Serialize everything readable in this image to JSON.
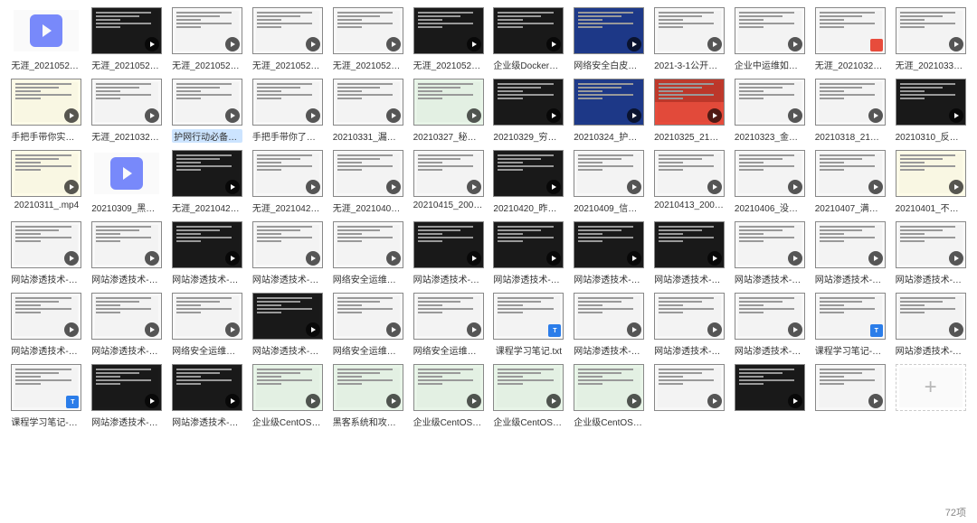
{
  "footer": "72项",
  "items": [
    {
      "label": "无涯_20210520_...",
      "type": "video-icon",
      "thumb": "vicon"
    },
    {
      "label": "无涯_20210521_...",
      "type": "video",
      "thumb": "dark"
    },
    {
      "label": "无涯_20210522_...",
      "type": "video",
      "thumb": "light"
    },
    {
      "label": "无涯_20210527_...",
      "type": "video",
      "thumb": "light"
    },
    {
      "label": "无涯_20210528_...",
      "type": "video",
      "thumb": "light"
    },
    {
      "label": "无涯_20210529_...",
      "type": "video",
      "thumb": "dark"
    },
    {
      "label": "企业级Docker容...",
      "type": "video",
      "thumb": "dark"
    },
    {
      "label": "网络安全白皮书V...",
      "type": "video",
      "thumb": "blue"
    },
    {
      "label": "2021-3-1公开课...",
      "type": "video",
      "thumb": "light"
    },
    {
      "label": "企业中运维如对...",
      "type": "video",
      "thumb": "light"
    },
    {
      "label": "无涯_20210328_...",
      "type": "pdf",
      "thumb": "light"
    },
    {
      "label": "无涯_20210330_...",
      "type": "video",
      "thumb": "light"
    },
    {
      "label": "手把手带你实现...",
      "type": "video",
      "thumb": "yellow"
    },
    {
      "label": "无涯_20210326_...",
      "type": "video",
      "thumb": "light"
    },
    {
      "label": "护网行动必备技...",
      "type": "video",
      "thumb": "light",
      "highlight": true
    },
    {
      "label": "手把手带你了解...",
      "type": "video",
      "thumb": "light"
    },
    {
      "label": "20210331_漏洞...",
      "type": "video",
      "thumb": "light"
    },
    {
      "label": "20210327_秘钥...",
      "type": "video",
      "thumb": "green"
    },
    {
      "label": "20210329_穷追...",
      "type": "video",
      "thumb": "dark"
    },
    {
      "label": "20210324_护网...",
      "type": "video",
      "thumb": "blue"
    },
    {
      "label": "20210325_21世...",
      "type": "video",
      "thumb": "redb"
    },
    {
      "label": "20210323_金三...",
      "type": "video",
      "thumb": "light"
    },
    {
      "label": "20210318_21世...",
      "type": "video",
      "thumb": "light"
    },
    {
      "label": "20210310_反黑...",
      "type": "video",
      "thumb": "dark"
    },
    {
      "label": "20210311_.mp4",
      "type": "video",
      "thumb": "yellow"
    },
    {
      "label": "20210309_黑客...",
      "type": "video-icon",
      "thumb": "vicon"
    },
    {
      "label": "无涯_20210424_...",
      "type": "video",
      "thumb": "dark"
    },
    {
      "label": "无涯_20210423_...",
      "type": "video",
      "thumb": "light"
    },
    {
      "label": "无涯_20210402_...",
      "type": "video",
      "thumb": "light"
    },
    {
      "label": "20210415_2005...",
      "type": "video",
      "thumb": "light"
    },
    {
      "label": "20210420_昨晚...",
      "type": "video",
      "thumb": "dark"
    },
    {
      "label": "20210409_信不...",
      "type": "video",
      "thumb": "light"
    },
    {
      "label": "20210413_2005...",
      "type": "video",
      "thumb": "light"
    },
    {
      "label": "20210406_没注...",
      "type": "video",
      "thumb": "light"
    },
    {
      "label": "20210407_满足...",
      "type": "video",
      "thumb": "light"
    },
    {
      "label": "20210401_不会...",
      "type": "video",
      "thumb": "yellow"
    },
    {
      "label": "网站渗透技术-03...",
      "type": "video",
      "thumb": "light"
    },
    {
      "label": "网站渗透技术-05...",
      "type": "video",
      "thumb": "light"
    },
    {
      "label": "网站渗透技术-01...",
      "type": "video",
      "thumb": "dark"
    },
    {
      "label": "网站渗透技术-06...",
      "type": "video",
      "thumb": "light"
    },
    {
      "label": "网络安全运维班...",
      "type": "video",
      "thumb": "light"
    },
    {
      "label": "网站渗透技术-04...",
      "type": "video",
      "thumb": "dark"
    },
    {
      "label": "网站渗透技术-02...",
      "type": "video",
      "thumb": "dark"
    },
    {
      "label": "网站渗透技术-02...",
      "type": "video",
      "thumb": "dark"
    },
    {
      "label": "网站渗透技术-07...",
      "type": "video",
      "thumb": "dark"
    },
    {
      "label": "网站渗透技术-03...",
      "type": "video",
      "thumb": "light"
    },
    {
      "label": "网站渗透技术-10...",
      "type": "video",
      "thumb": "light"
    },
    {
      "label": "网站渗透技术-08...",
      "type": "video",
      "thumb": "light"
    },
    {
      "label": "网站渗透技术-09...",
      "type": "video",
      "thumb": "light"
    },
    {
      "label": "网站渗透技术-06...",
      "type": "video",
      "thumb": "light"
    },
    {
      "label": "网络安全运维班...",
      "type": "video",
      "thumb": "light"
    },
    {
      "label": "网站渗透技术-05...",
      "type": "video",
      "thumb": "dark"
    },
    {
      "label": "网络安全运维班...",
      "type": "video",
      "thumb": "light"
    },
    {
      "label": "网络安全运维班...",
      "type": "video",
      "thumb": "light"
    },
    {
      "label": "课程学习笔记.txt",
      "type": "txt",
      "thumb": "light"
    },
    {
      "label": "网站渗透技术-01...",
      "type": "video",
      "thumb": "light"
    },
    {
      "label": "网站渗透技术-04...",
      "type": "video",
      "thumb": "light"
    },
    {
      "label": "网站渗透技术-03...",
      "type": "video",
      "thumb": "light"
    },
    {
      "label": "课程学习笔记-02...",
      "type": "txt",
      "thumb": "light"
    },
    {
      "label": "网站渗透技术-02...",
      "type": "video",
      "thumb": "light"
    },
    {
      "label": "课程学习笔记-01...",
      "type": "txt",
      "thumb": "light"
    },
    {
      "label": "网站渗透技术-02...",
      "type": "video",
      "thumb": "dark"
    },
    {
      "label": "网站渗透技术-02...",
      "type": "video",
      "thumb": "dark"
    },
    {
      "label": "企业级CentOS系...",
      "type": "video",
      "thumb": "green"
    },
    {
      "label": "黑客系统和攻防...",
      "type": "video",
      "thumb": "green"
    },
    {
      "label": "企业级CentOS系...",
      "type": "video",
      "thumb": "green"
    },
    {
      "label": "企业级CentOS系...",
      "type": "video",
      "thumb": "green"
    },
    {
      "label": "企业级CentOS系...",
      "type": "video",
      "thumb": "green"
    },
    {
      "label": "",
      "type": "video",
      "thumb": "light",
      "partial": true
    },
    {
      "label": "",
      "type": "video",
      "thumb": "dark",
      "partial": true
    },
    {
      "label": "",
      "type": "video",
      "thumb": "light",
      "partial": true
    },
    {
      "label": "",
      "type": "plus",
      "thumb": "plus",
      "partial": true
    }
  ]
}
